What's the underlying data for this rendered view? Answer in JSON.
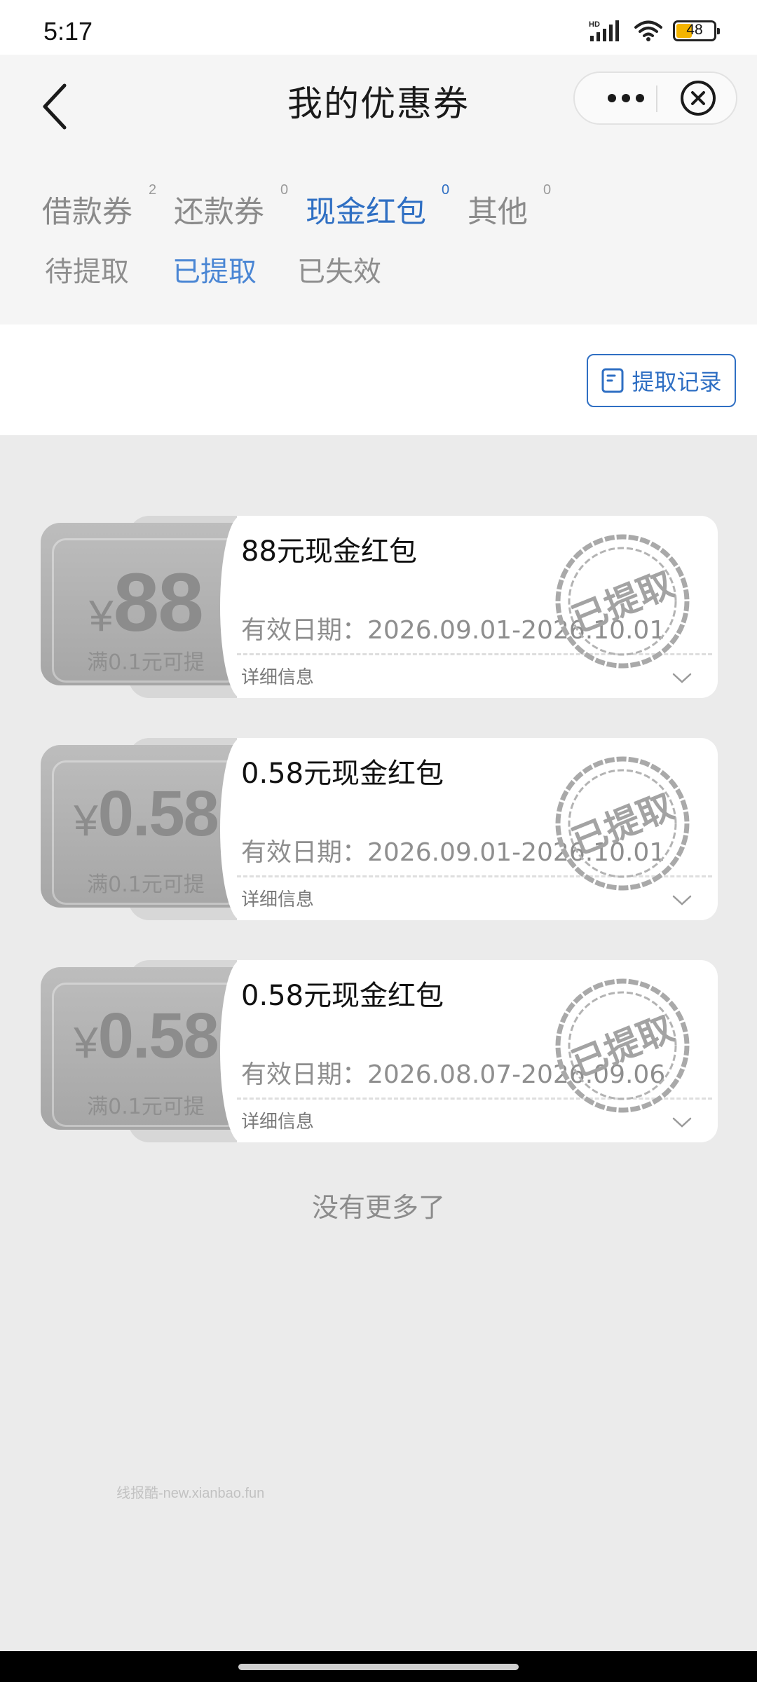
{
  "status_bar": {
    "time": "5:17",
    "signal_badge": "HD",
    "battery_level": "48",
    "icons": [
      "signal-icon",
      "wifi-icon",
      "battery-icon"
    ]
  },
  "header": {
    "title": "我的优惠券",
    "back_icon": "chevron-left-icon",
    "more_icon": "more-dots-icon",
    "close_icon": "close-circle-icon"
  },
  "tabs": [
    {
      "label": "借款券",
      "count": "2",
      "active": false
    },
    {
      "label": "还款券",
      "count": "0",
      "active": false
    },
    {
      "label": "现金红包",
      "count": "0",
      "active": true
    },
    {
      "label": "其他",
      "count": "0",
      "active": false
    }
  ],
  "sub_tabs": [
    {
      "label": "待提取",
      "active": false
    },
    {
      "label": "已提取",
      "active": true
    },
    {
      "label": "已失效",
      "active": false
    }
  ],
  "toolbar": {
    "record_label": "提取记录",
    "record_icon": "document-icon"
  },
  "coupons": [
    {
      "currency": "¥",
      "amount": "88",
      "condition": "满0.1元可提",
      "title": "88元现金红包",
      "validity": "有效日期：2026.09.01-2026.10.01",
      "detail_label": "详细信息",
      "stamp_text": "已提取"
    },
    {
      "currency": "¥",
      "amount": "0.58",
      "condition": "满0.1元可提",
      "title": "0.58元现金红包",
      "validity": "有效日期：2026.09.01-2026.10.01",
      "detail_label": "详细信息",
      "stamp_text": "已提取"
    },
    {
      "currency": "¥",
      "amount": "0.58",
      "condition": "满0.1元可提",
      "title": "0.58元现金红包",
      "validity": "有效日期：2026.08.07-2026.09.06",
      "detail_label": "详细信息",
      "stamp_text": "已提取"
    }
  ],
  "footer": {
    "no_more": "没有更多了",
    "watermark": "线报酷-new.xianbao.fun"
  },
  "colors": {
    "accent": "#2f6fc3",
    "sub_accent": "#4a86d4",
    "coupon_gray": "#a6a6a6",
    "page_bg": "#ebebeb"
  }
}
